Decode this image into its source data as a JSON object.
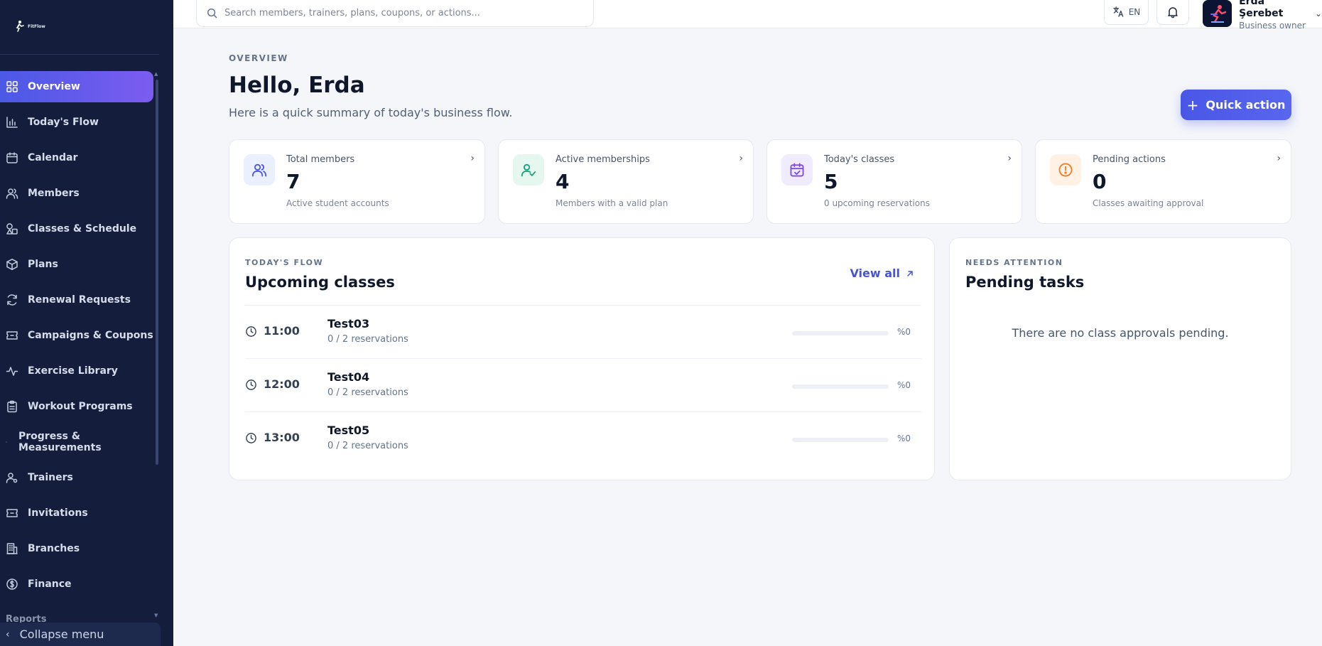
{
  "app": {
    "logo_text": "FitFlow"
  },
  "sidebar": {
    "items": [
      {
        "label": "Overview",
        "icon": "grid-icon",
        "active": true
      },
      {
        "label": "Today's Flow",
        "icon": "bar-chart-icon"
      },
      {
        "label": "Calendar",
        "icon": "calendar-icon"
      },
      {
        "label": "Members",
        "icon": "users-icon"
      },
      {
        "label": "Classes & Schedule",
        "icon": "shapes-icon"
      },
      {
        "label": "Plans",
        "icon": "package-icon"
      },
      {
        "label": "Renewal Requests",
        "icon": "refresh-icon"
      },
      {
        "label": "Campaigns & Coupons",
        "icon": "ticket-icon"
      },
      {
        "label": "Exercise Library",
        "icon": "activity-icon"
      },
      {
        "label": "Workout Programs",
        "icon": "clipboard-icon"
      },
      {
        "label": "Progress & Measurements",
        "icon": "bullet-icon"
      },
      {
        "label": "Trainers",
        "icon": "user-cog-icon"
      },
      {
        "label": "Invitations",
        "icon": "ticket-icon"
      },
      {
        "label": "Branches",
        "icon": "building-icon"
      },
      {
        "label": "Finance",
        "icon": "dollar-icon"
      }
    ],
    "peek_label": "Reports",
    "collapse_label": "Collapse menu"
  },
  "topbar": {
    "search_placeholder": "Search members, trainers, plans, coupons, or actions...",
    "language": "EN",
    "user_name": "Erda Şerebet",
    "user_role": "Business owner"
  },
  "hero": {
    "eyebrow": "OVERVIEW",
    "title": "Hello, Erda",
    "subtitle": "Here is a quick summary of today's business flow.",
    "quick_action_label": "Quick action"
  },
  "stats": [
    {
      "label": "Total members",
      "value": "7",
      "desc": "Active student accounts",
      "icon": "users-icon",
      "tile_color": "#eaf0ff",
      "icon_color": "#4a56e6"
    },
    {
      "label": "Active memberships",
      "value": "4",
      "desc": "Members with a valid plan",
      "icon": "user-check-icon",
      "tile_color": "#e6f7f0",
      "icon_color": "#16a37a"
    },
    {
      "label": "Today's classes",
      "value": "5",
      "desc": "0 upcoming reservations",
      "icon": "calendar-check-icon",
      "tile_color": "#f1ebff",
      "icon_color": "#7c4ddb"
    },
    {
      "label": "Pending actions",
      "value": "0",
      "desc": "Classes awaiting approval",
      "icon": "alert-circle-icon",
      "tile_color": "#fff1e4",
      "icon_color": "#e8802e"
    }
  ],
  "upcoming": {
    "eyebrow": "TODAY'S FLOW",
    "title": "Upcoming classes",
    "view_all_label": "View all",
    "rows": [
      {
        "time": "11:00",
        "name": "Test03",
        "reservations": "0 / 2 reservations",
        "percent": "%0",
        "fill": 0
      },
      {
        "time": "12:00",
        "name": "Test04",
        "reservations": "0 / 2 reservations",
        "percent": "%0",
        "fill": 0
      },
      {
        "time": "13:00",
        "name": "Test05",
        "reservations": "0 / 2 reservations",
        "percent": "%0",
        "fill": 0
      }
    ]
  },
  "pending": {
    "eyebrow": "NEEDS ATTENTION",
    "title": "Pending tasks",
    "empty_text": "There are no class approvals pending."
  }
}
